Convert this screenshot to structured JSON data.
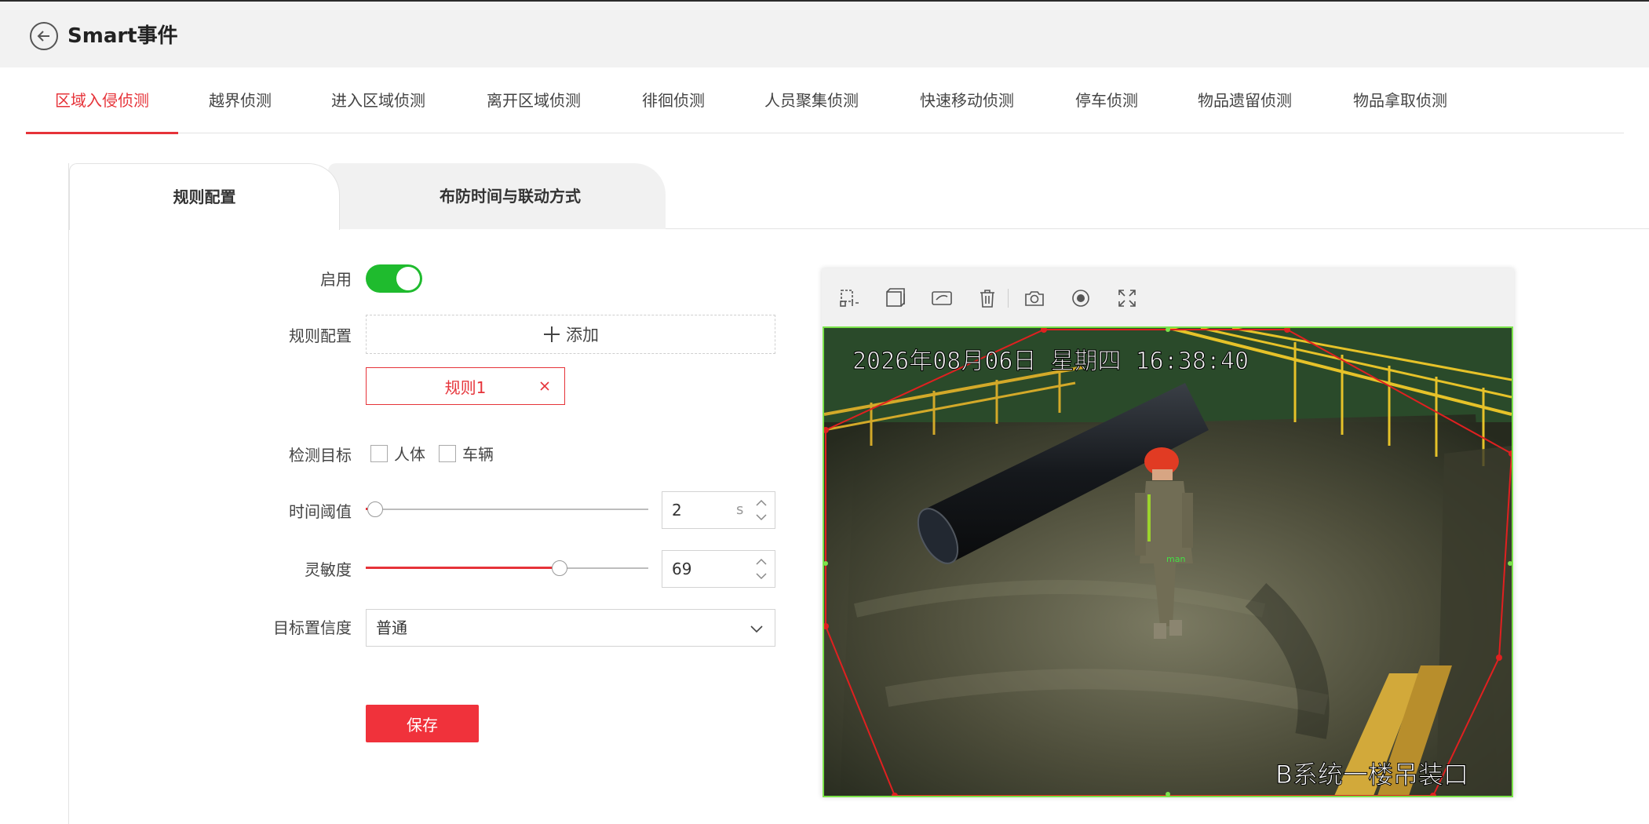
{
  "header": {
    "title": "Smart事件"
  },
  "event_tabs": [
    {
      "label": "区域入侵侦测",
      "active": true
    },
    {
      "label": "越界侦测",
      "active": false
    },
    {
      "label": "进入区域侦测",
      "active": false
    },
    {
      "label": "离开区域侦测",
      "active": false
    },
    {
      "label": "徘徊侦测",
      "active": false
    },
    {
      "label": "人员聚集侦测",
      "active": false
    },
    {
      "label": "快速移动侦测",
      "active": false
    },
    {
      "label": "停车侦测",
      "active": false
    },
    {
      "label": "物品遗留侦测",
      "active": false
    },
    {
      "label": "物品拿取侦测",
      "active": false
    }
  ],
  "sub_tabs": {
    "rule_config": "规则配置",
    "schedule": "布防时间与联动方式"
  },
  "form": {
    "enable_label": "启用",
    "enable_on": true,
    "rule_config_label": "规则配置",
    "add_label": "添加",
    "rule_chip": "规则1",
    "detect_target_label": "检测目标",
    "targets": [
      {
        "label": "人体",
        "checked": false
      },
      {
        "label": "车辆",
        "checked": false
      }
    ],
    "time_threshold_label": "时间阈值",
    "time_threshold_value": "2",
    "time_threshold_unit": "s",
    "sensitivity_label": "灵敏度",
    "sensitivity_value": "69",
    "confidence_label": "目标置信度",
    "confidence_value": "普通",
    "save_label": "保存"
  },
  "video": {
    "osd_time": "2026年08月06日  星期四  16:38:40",
    "osd_name": "B系统一楼吊装口",
    "target_tag": "man"
  },
  "colors": {
    "accent": "#e63339",
    "toggle_on": "#1fbb2e",
    "roi_line": "#e02020",
    "frame_border": "#7be24a"
  }
}
